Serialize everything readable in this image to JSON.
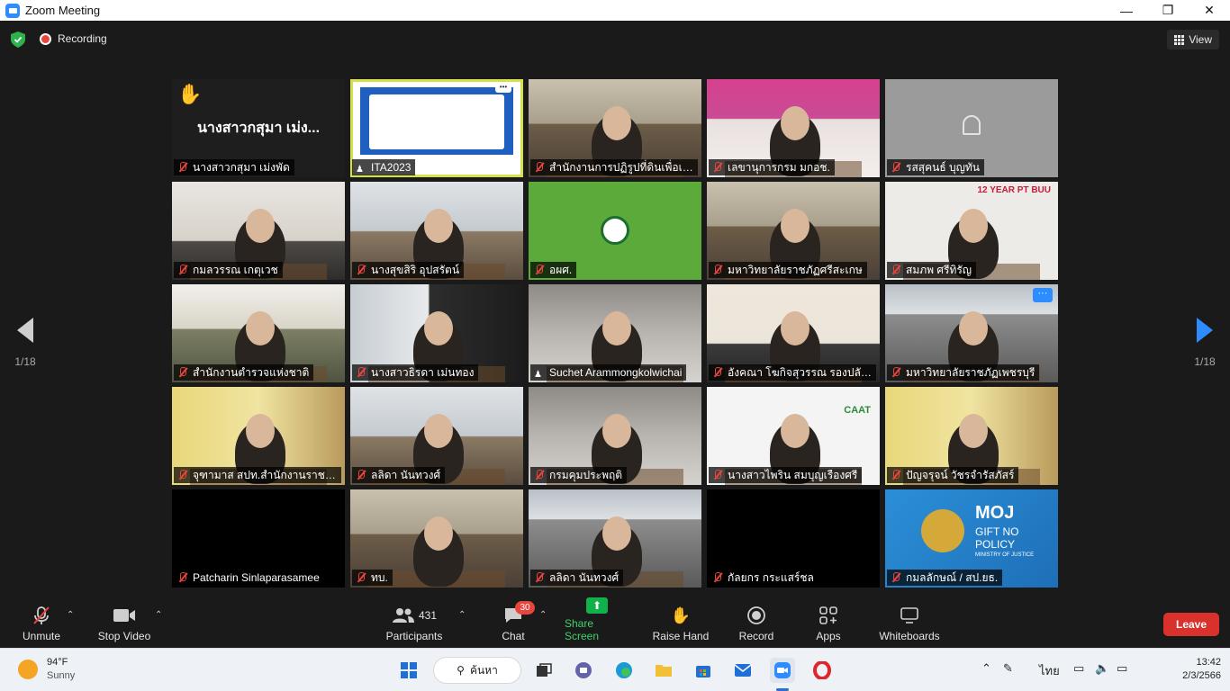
{
  "window": {
    "title": "Zoom Meeting",
    "minimize": "—",
    "maximize": "❐",
    "close": "✕"
  },
  "header": {
    "recording_label": "Recording",
    "view_label": "View"
  },
  "pagination": {
    "left": "1/18",
    "right": "1/18"
  },
  "tiles": [
    {
      "name": "นางสาวกสุมา เม่งพัด",
      "big_name": "นางสาวกสุมา เม่ง...",
      "scene": "dark",
      "muted": true,
      "hand": true
    },
    {
      "name": "ITA2023",
      "scene": "share",
      "muted": false
    },
    {
      "name": "สำนักงานการปฏิรูปที่ดินเพื่อเกษ...",
      "scene": "room",
      "muted": true
    },
    {
      "name": "เลขานุการกรม มกอช.",
      "scene": "pink",
      "muted": true
    },
    {
      "name": "รสสุคนธ์ บุญทัน",
      "scene": "grey",
      "muted": true
    },
    {
      "name": "กมลวรรณ เกตุเวช",
      "scene": "office",
      "muted": true
    },
    {
      "name": "นางสุขสิริ อุปสรัตน์",
      "scene": "room2",
      "muted": true
    },
    {
      "name": "อผศ.",
      "scene": "green",
      "muted": true
    },
    {
      "name": "มหาวิทยาลัยราชภัฏศรีสะเกษ",
      "scene": "room",
      "muted": true
    },
    {
      "name": "สมภพ ศรีทิรัญ",
      "scene": "light",
      "muted": true,
      "badge": "12 YEAR PT BUU"
    },
    {
      "name": "สำนักงานตำรวจแห่งชาติ",
      "scene": "police",
      "muted": true
    },
    {
      "name": "นางสาวธิรดา เม่นทอง",
      "scene": "modern",
      "muted": true
    },
    {
      "name": "Suchet Arammongkolwichai",
      "scene": "blur",
      "muted": false
    },
    {
      "name": "อังคณา โฆกิจสุวรรณ รองปลัดก...",
      "scene": "court",
      "muted": true
    },
    {
      "name": "มหาวิทยาลัยราชภัฏเพชรบุรี",
      "scene": "class",
      "muted": true,
      "more": "···"
    },
    {
      "name": "จุฑามาส สปท.สำนักงานราชบัณ...",
      "scene": "yellowoffice",
      "muted": true
    },
    {
      "name": "ลลิดา นันทวงศ์",
      "scene": "room2",
      "muted": true
    },
    {
      "name": "กรมคุมประพฤติ",
      "scene": "blur",
      "muted": true
    },
    {
      "name": "นางสาวไพริน สมบุญเรืองศรี",
      "scene": "white",
      "muted": true,
      "badge": "CAAT"
    },
    {
      "name": "ปัญจรุจน์ วัชรจำรัสภัสร์",
      "scene": "yellow",
      "muted": true
    },
    {
      "name": "Patcharin Sinlaparasamee",
      "scene": "black",
      "muted": true
    },
    {
      "name": "ทบ.",
      "scene": "room",
      "muted": true
    },
    {
      "name": "ลลิดา นันทวงศ์",
      "scene": "class",
      "muted": true
    },
    {
      "name": "กัลยกร กระแสร์ชล",
      "scene": "black",
      "muted": true
    },
    {
      "name": "กมลลักษณ์ / สป.ยธ.",
      "scene": "moj",
      "muted": true,
      "moj": {
        "title": "MOJ",
        "line": "GIFT NO POLICY",
        "sub": "MINISTRY OF JUSTICE"
      }
    }
  ],
  "toolbar": {
    "unmute": "Unmute",
    "stop_video": "Stop Video",
    "participants": "Participants",
    "participants_count": "431",
    "chat": "Chat",
    "chat_badge": "30",
    "share_screen": "Share Screen",
    "raise_hand": "Raise Hand",
    "record": "Record",
    "apps": "Apps",
    "whiteboards": "Whiteboards",
    "leave": "Leave"
  },
  "taskbar": {
    "temperature": "94°F",
    "condition": "Sunny",
    "search_label": "ค้นหา",
    "language": "ไทย",
    "time": "13:42",
    "date": "2/3/2566"
  },
  "colors": {
    "accent": "#2d8cff",
    "leave": "#d9312b",
    "share": "#10b04b",
    "record_dot": "#e8453c"
  }
}
